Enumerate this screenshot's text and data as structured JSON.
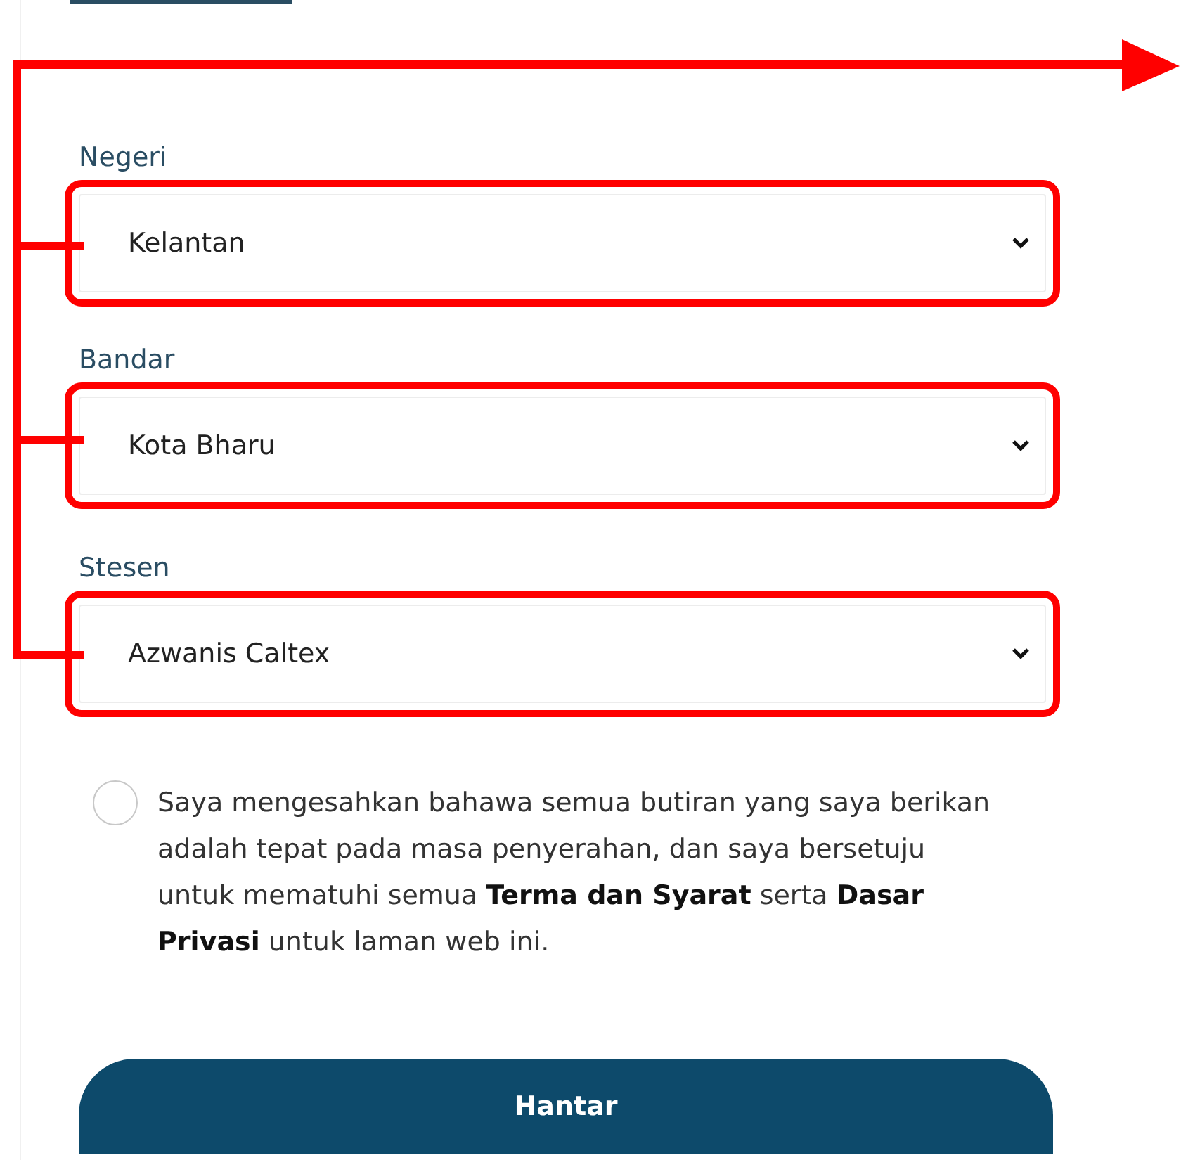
{
  "fields": [
    {
      "label": "Negeri",
      "value": "Kelantan",
      "highlighted": true
    },
    {
      "label": "Bandar",
      "value": "Kota Bharu",
      "highlighted": true
    },
    {
      "label": "Stesen",
      "value": "Azwanis Caltex",
      "highlighted": true
    }
  ],
  "annotation": {
    "kind": "bracket-arrow"
  },
  "consent": {
    "checked": false,
    "text": "Saya mengesahkan bahawa semua butiran yang saya berikan adalah tepat pada masa penyerahan, dan saya bersetuju untuk mematuhi semua **Terma dan Syarat** serta **Dasar Privasi** untuk laman web ini."
  },
  "submit_button": {
    "label": "Hantar"
  }
}
